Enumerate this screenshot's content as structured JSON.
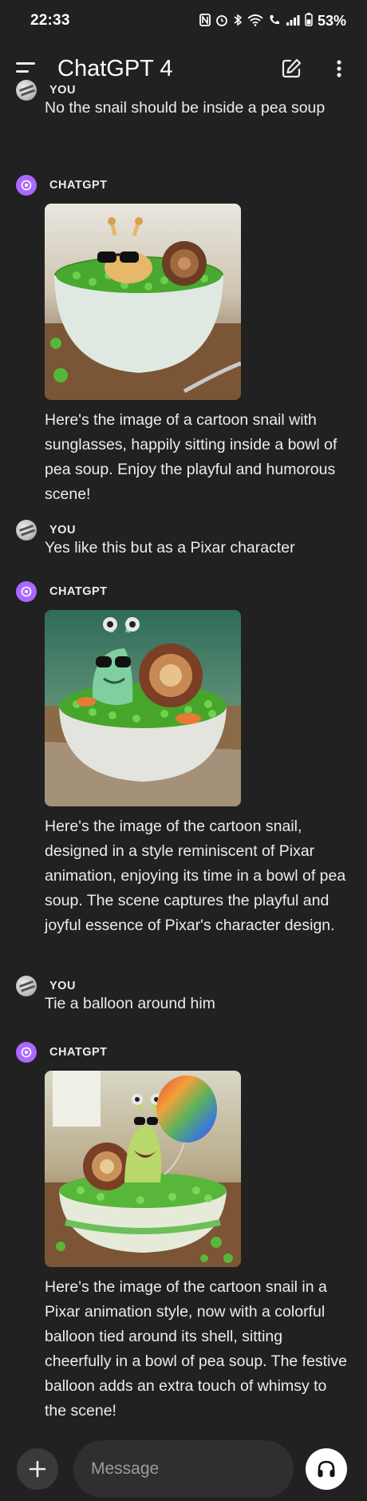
{
  "status_bar": {
    "time": "22:33",
    "icons": [
      "nfc-icon",
      "alarm-icon",
      "bluetooth-icon",
      "wifi-icon",
      "wifi-call-icon",
      "signal-icon",
      "battery-icon"
    ],
    "battery": "53%"
  },
  "app_bar": {
    "title": "ChatGPT 4",
    "icons": [
      "menu-icon",
      "new-chat-icon",
      "more-options-icon"
    ]
  },
  "messages": [
    {
      "role": "user",
      "sender": "YOU",
      "text": "No the snail should be inside a pea soup"
    },
    {
      "role": "assistant",
      "sender": "CHATGPT",
      "image": "snail-sunglasses-pea-soup",
      "text": "Here's the image of a cartoon snail with sunglasses, happily sitting inside a bowl of pea soup. Enjoy the playful and humorous scene!"
    },
    {
      "role": "user",
      "sender": "YOU",
      "text": "Yes like this but as a Pixar character"
    },
    {
      "role": "assistant",
      "sender": "CHATGPT",
      "image": "pixar-snail-pea-soup",
      "text": "Here's the image of the cartoon snail, designed in a style reminiscent of Pixar animation, enjoying its time in a bowl of pea soup. The scene captures the playful and joyful essence of Pixar's character design."
    },
    {
      "role": "user",
      "sender": "YOU",
      "text": "Tie a balloon around him"
    },
    {
      "role": "assistant",
      "sender": "CHATGPT",
      "image": "pixar-snail-balloon",
      "text": "Here's the image of the cartoon snail in a Pixar animation style, now with a colorful balloon tied around its shell, sitting cheerfully in a bowl of pea soup. The festive balloon adds an extra touch of whimsy to the scene!"
    }
  ],
  "composer": {
    "placeholder": "Message",
    "icons": [
      "plus-icon",
      "waveform-icon",
      "headphones-icon"
    ]
  },
  "colors": {
    "background": "#212121",
    "text": "#ececec",
    "gpt_avatar": "#ab68ff",
    "input_bg": "#2f2f2f"
  }
}
